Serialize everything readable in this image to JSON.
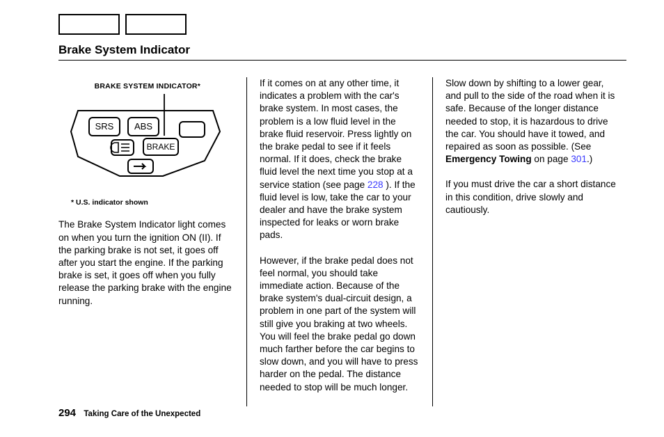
{
  "title": "Brake System Indicator",
  "figure": {
    "label": "BRAKE SYSTEM INDICATOR*",
    "note": "*  U.S. indicator shown",
    "tokens": {
      "srs": "SRS",
      "abs": "ABS",
      "brake": "BRAKE"
    }
  },
  "col1": {
    "p1": "The Brake System Indicator light comes on when you turn the ignition ON (II). If the parking brake is not set, it goes off after you start the engine. If the parking brake is set, it goes off when you fully release the parking brake with the engine running."
  },
  "col2": {
    "p1a": "If it comes on at any other time, it indicates a problem with the car's brake system. In most cases, the problem is a low fluid level in the brake fluid reservoir. Press lightly on the brake pedal to see if it feels normal. If it does, check the brake fluid level the next time you stop at a service station (see page ",
    "link1": "228",
    "p1b": " ). If the fluid level is low, take the car to your dealer and have the brake system inspected for leaks or worn brake pads.",
    "p2": "However, if the brake pedal does not feel normal, you should take immediate action. Because of the brake system's dual-circuit design, a problem in one part of the system will still give you braking at two wheels. You will feel the brake pedal go down much farther before the car begins to slow down, and you will have to press harder on the pedal. The distance needed to stop will be much longer."
  },
  "col3": {
    "p1a": "Slow down by shifting to a lower gear, and pull to the side of the road when it is safe. Because of the longer distance needed to stop, it is hazardous to drive the car. You should have it towed, and repaired as soon as possible. (See ",
    "bold1": "Emergency Towing",
    "p1b": " on page ",
    "link1": "301",
    "p1c": ".)",
    "p2": "If you must drive the car a short distance in this condition, drive slowly and cautiously."
  },
  "footer": {
    "page": "294",
    "section": "Taking Care of the Unexpected"
  }
}
